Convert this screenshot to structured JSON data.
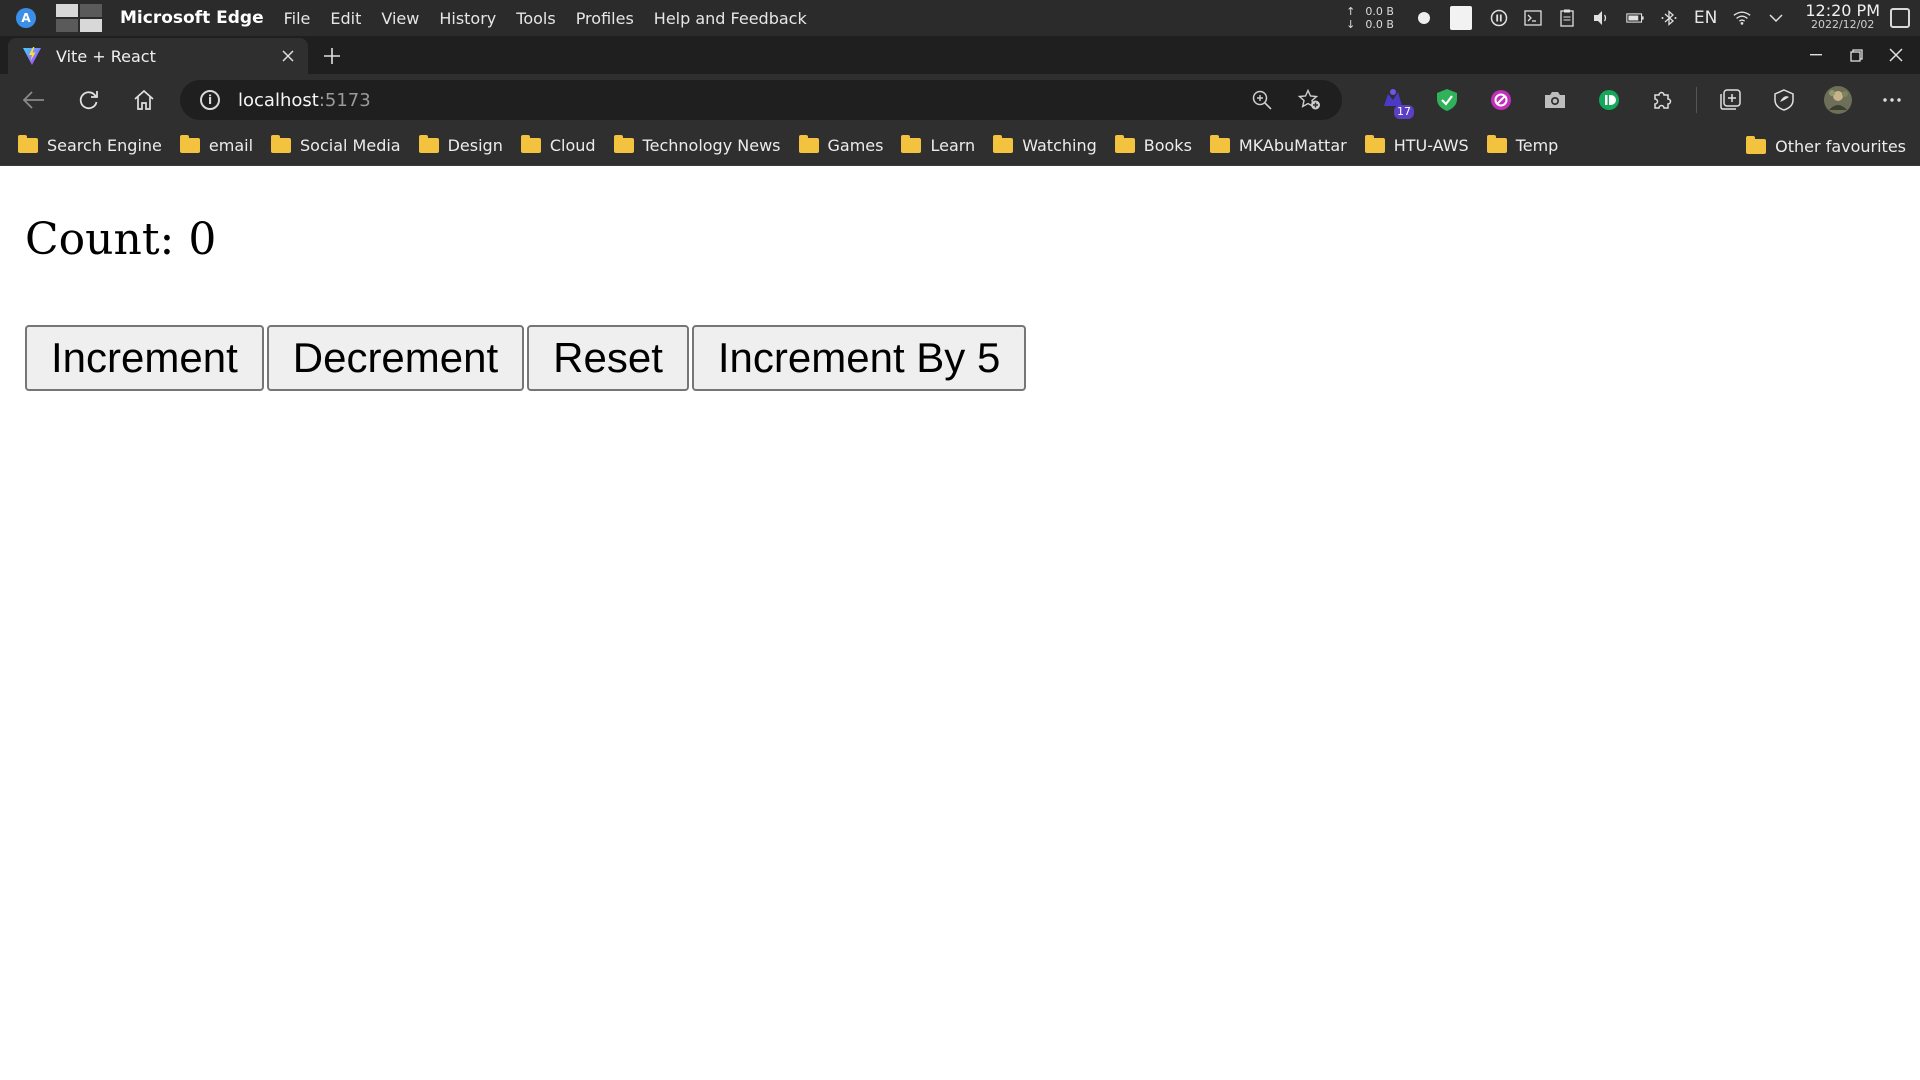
{
  "system_bar": {
    "app_name": "Microsoft Edge",
    "menu": [
      "File",
      "Edit",
      "View",
      "History",
      "Tools",
      "Profiles",
      "Help and Feedback"
    ],
    "net_up": "0.0 B",
    "net_down": "0.0 B",
    "up_arrow": "↑",
    "down_arrow": "↓",
    "language": "EN",
    "time": "12:20 PM",
    "date": "2022/12/02"
  },
  "tab": {
    "title": "Vite + React"
  },
  "toolbar": {
    "url_host": "localhost",
    "url_port": ":5173",
    "extension_badge": "17"
  },
  "bookmarks": {
    "items": [
      "Search Engine",
      "email",
      "Social Media",
      "Design",
      "Cloud",
      "Technology News",
      "Games",
      "Learn",
      "Watching",
      "Books",
      "MKAbuMattar",
      "HTU-AWS",
      "Temp"
    ],
    "other": "Other favourites"
  },
  "page": {
    "count_text": "Count: 0",
    "buttons": [
      "Increment",
      "Decrement",
      "Reset",
      "Increment By 5"
    ]
  }
}
